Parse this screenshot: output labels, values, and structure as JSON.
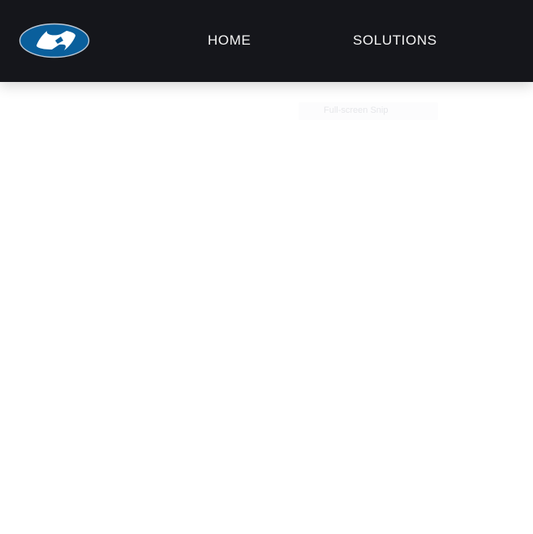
{
  "header": {
    "logo_icon": "brand-logo-icon",
    "nav": [
      {
        "label": "HOME"
      },
      {
        "label": "SOLUTIONS"
      }
    ],
    "background_color": "#15161b",
    "nav_text_color": "#f4f4f4"
  },
  "overlay": {
    "tooltip_text": "Full-screen Snip"
  },
  "colors": {
    "logo_blue": "#0a5f9c",
    "logo_white": "#ffffff",
    "page_background": "#ffffff"
  }
}
